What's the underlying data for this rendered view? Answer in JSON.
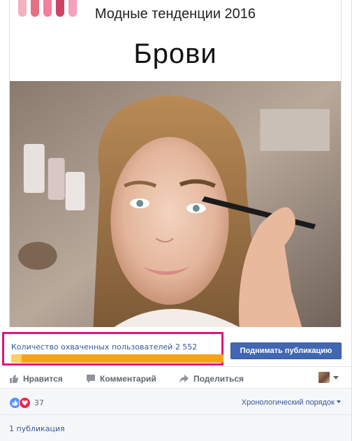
{
  "post": {
    "banner_subtitle": "Модные тенденции 2016",
    "banner_title": "Брови"
  },
  "reach": {
    "label": "Количество охваченных пользователей 2 552",
    "progress_fraction": 0.05
  },
  "boost_button": "Поднимать публикацию",
  "actions": {
    "like": "Нравится",
    "comment": "Комментарий",
    "share": "Поделиться"
  },
  "reactions": {
    "count": "37"
  },
  "sort_label": "Хронологический порядок",
  "publications": "1 публикация",
  "colors": {
    "accent": "#4267b2",
    "link": "#365899",
    "highlight": "#e5127d",
    "progress": "#f7a21b"
  }
}
